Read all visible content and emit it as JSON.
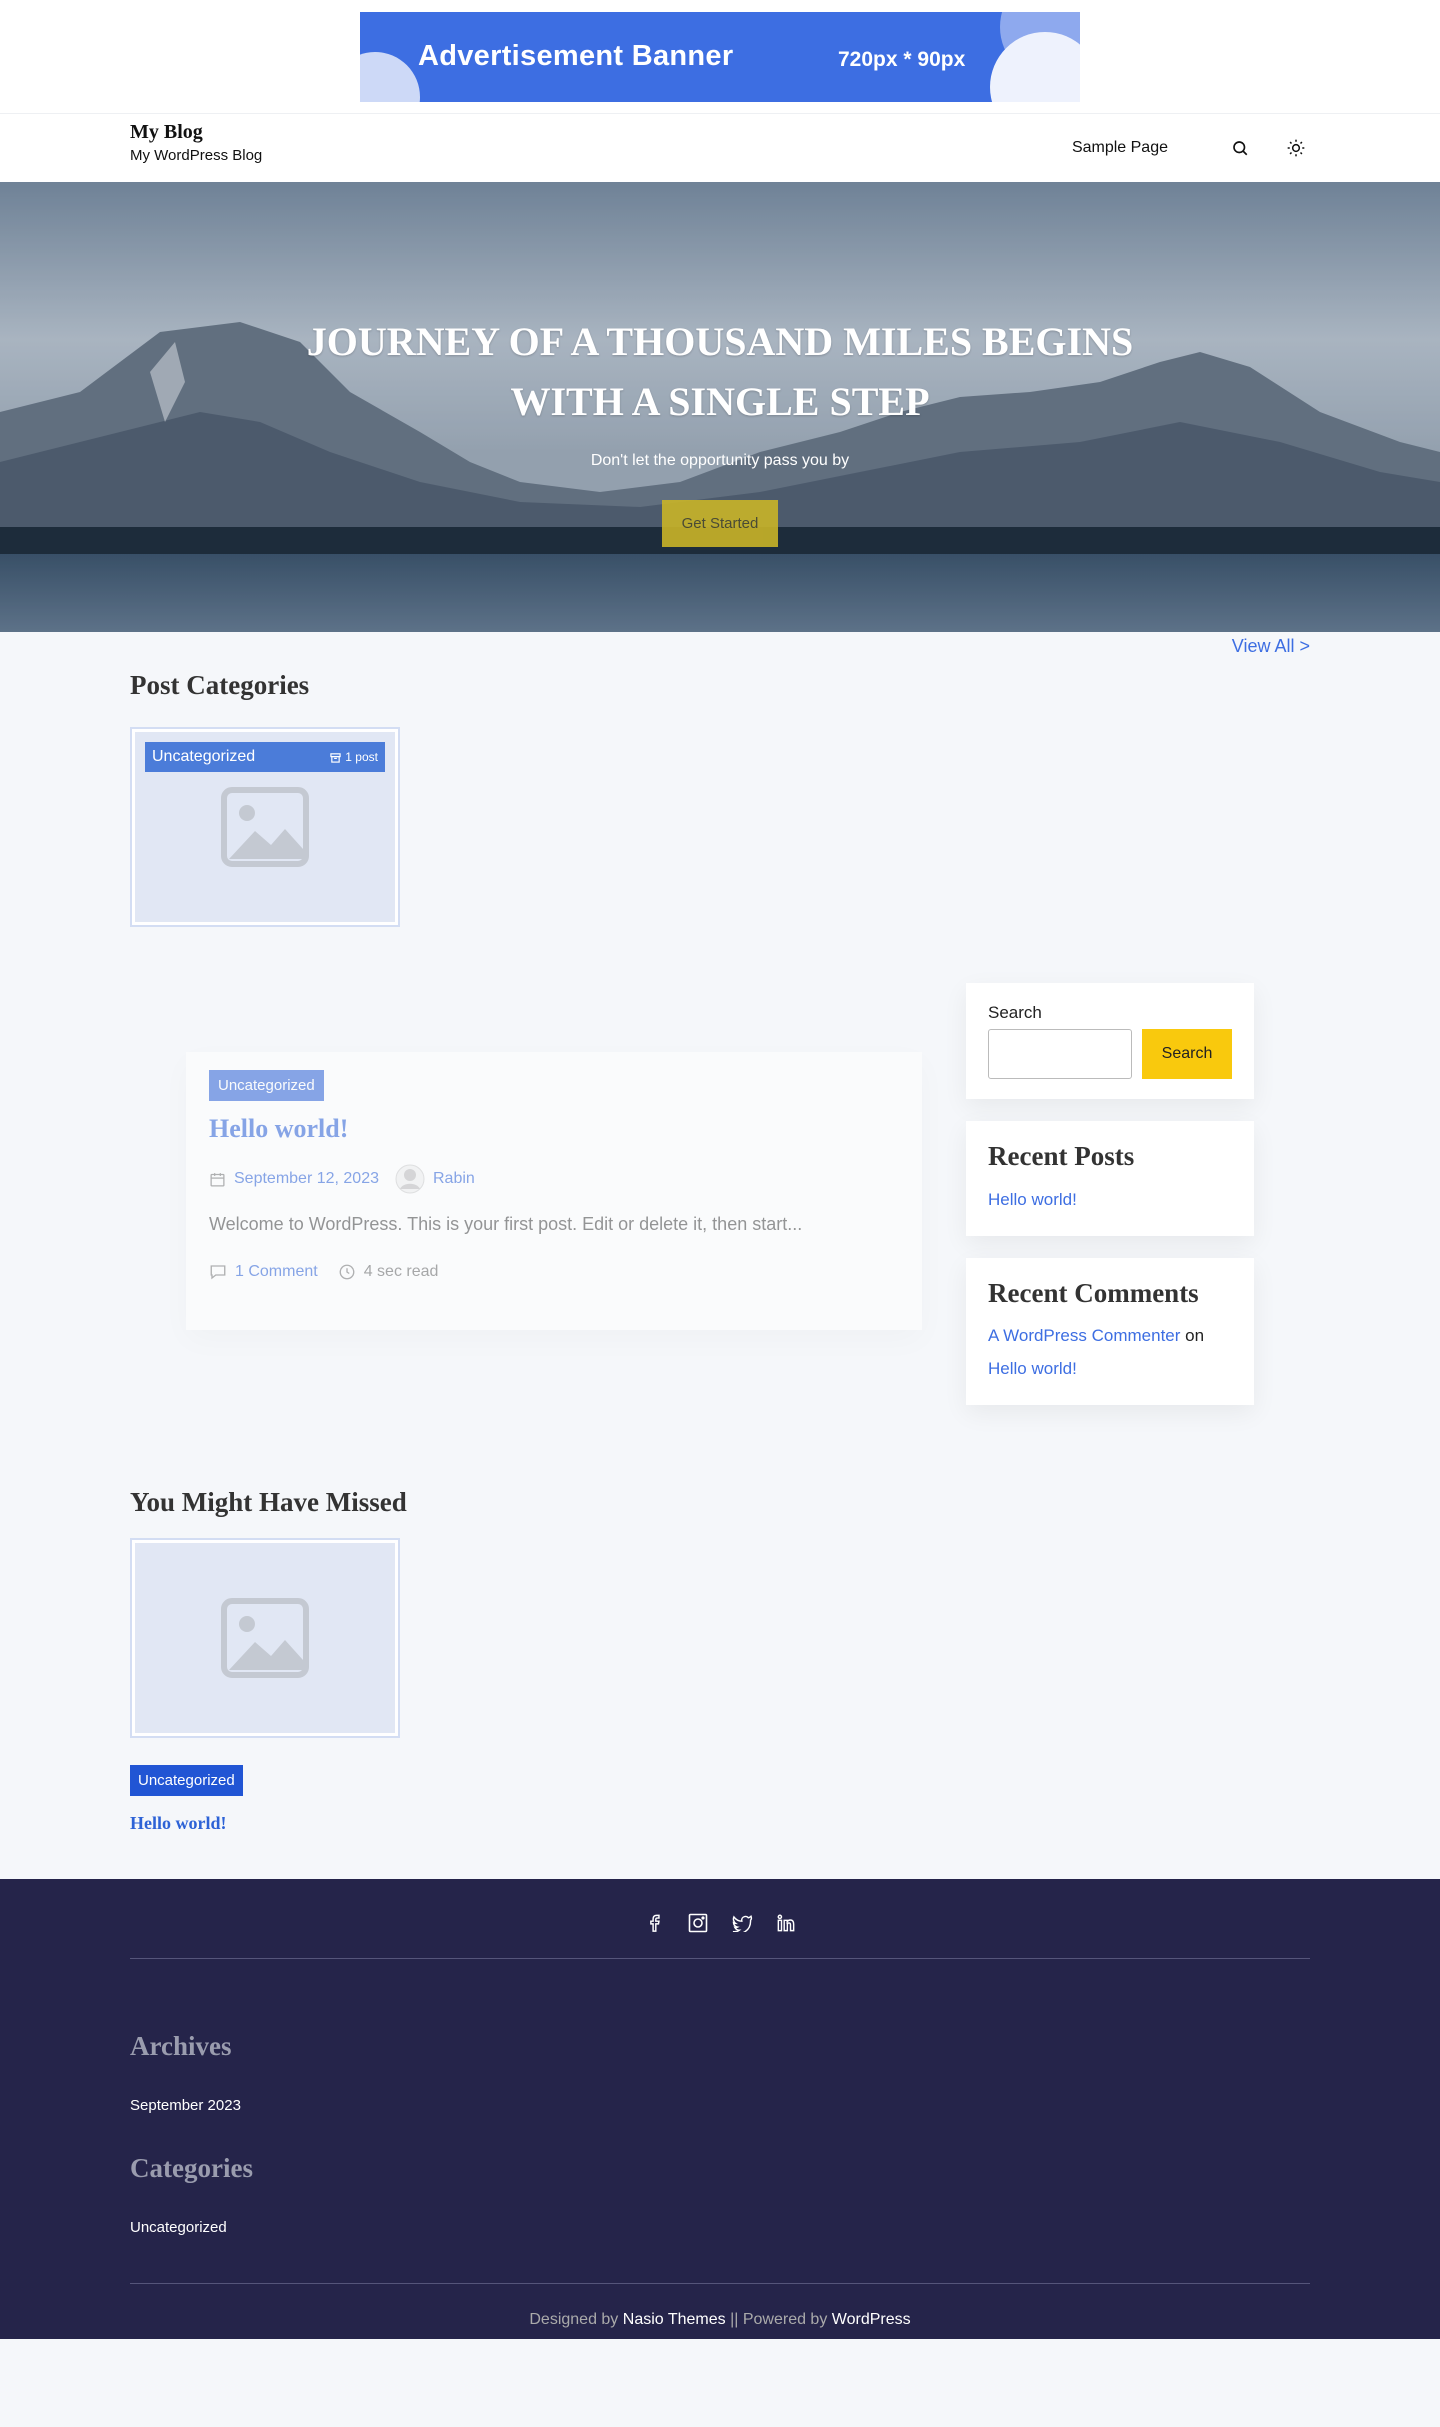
{
  "ad": {
    "title": "Advertisement Banner",
    "size": "720px * 90px"
  },
  "site": {
    "name": "My Blog",
    "tagline": "My WordPress Blog"
  },
  "nav": {
    "sample_page": "Sample Page",
    "search_icon": "search-icon",
    "theme_icon": "sun-icon"
  },
  "hero": {
    "title": "JOURNEY OF A THOUSAND MILES BEGINS WITH A SINGLE STEP",
    "subtitle": "Don't let the opportunity pass you by",
    "button": "Get Started"
  },
  "categories": {
    "title": "Post Categories",
    "view_all": "View All >",
    "items": [
      {
        "name": "Uncategorized",
        "count": "1 post"
      }
    ]
  },
  "post": {
    "category": "Uncategorized",
    "title": "Hello world!",
    "date": "September 12, 2023",
    "author": "Rabin",
    "excerpt": "Welcome to WordPress. This is your first post. Edit or delete it, then start...",
    "comments": "1 Comment",
    "read_time": "4 sec read"
  },
  "sidebar": {
    "search_label": "Search",
    "search_button": "Search",
    "recent_posts_title": "Recent Posts",
    "recent_posts": [
      "Hello world!"
    ],
    "recent_comments_title": "Recent Comments",
    "comment_author": "A WordPress Commenter",
    "comment_on": "on",
    "comment_post": "Hello world!"
  },
  "missed": {
    "title": "You Might Have Missed",
    "category": "Uncategorized",
    "post_title": "Hello world!"
  },
  "footer": {
    "social": [
      "facebook-icon",
      "instagram-icon",
      "twitter-icon",
      "linkedin-icon"
    ],
    "archives_title": "Archives",
    "archives": [
      "September 2023"
    ],
    "categories_title": "Categories",
    "categories": [
      "Uncategorized"
    ],
    "designed_by": "Designed by",
    "designer": "Nasio Themes",
    "separator": "|| Powered by",
    "powered": "WordPress"
  },
  "colors": {
    "accent": "#3d6ee2",
    "button_yellow": "#f9c90d",
    "footer_bg": "#25244a"
  }
}
